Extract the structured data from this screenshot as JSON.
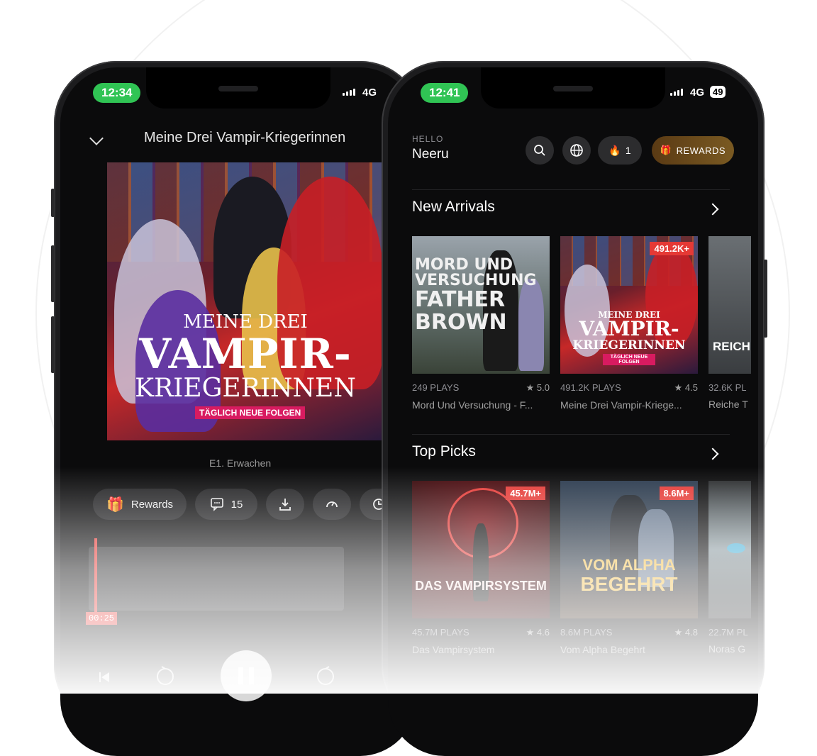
{
  "left_phone": {
    "status_time": "12:34",
    "network": "4G",
    "title": "Meine Drei Vampir-Kriegerinnen",
    "cover": {
      "line1": "MEINE DREI",
      "line2": "VAMPIR-",
      "line3": "KRIEGERINNEN",
      "tag": "TÄGLICH NEUE FOLGEN"
    },
    "episode": "E1. Erwachen",
    "controls": {
      "rewards_label": "Rewards",
      "comments_count": "15"
    },
    "timestamp": "00:25",
    "icons": [
      "chevron-down-icon",
      "gift-icon",
      "comment-icon",
      "download-icon",
      "speed-icon",
      "sleep-timer-icon",
      "skip-previous-icon",
      "rewind-10-icon",
      "pause-icon",
      "forward-10-icon"
    ]
  },
  "right_phone": {
    "status_time": "12:41",
    "network": "4G",
    "battery": "49",
    "hello": "HELLO",
    "username": "Neeru",
    "streak_count": "1",
    "rewards_label": "REWARDS",
    "sections": [
      {
        "title": "New Arrivals",
        "cards": [
          {
            "plays": "249 PLAYS",
            "rating": "5.0",
            "name": "Mord Und Versuchung - F...",
            "art_lines": [
              "MORD UND",
              "VERSUCHUNG",
              "FATHER",
              "BROWN"
            ],
            "badge": ""
          },
          {
            "plays": "491.2K PLAYS",
            "rating": "4.5",
            "name": "Meine Drei Vampir-Kriege...",
            "art_lines": [
              "MEINE DREI",
              "VAMPIR-",
              "KRIEGERINNEN",
              "TÄGLICH NEUE FOLGEN"
            ],
            "badge": "491.2K+"
          },
          {
            "plays": "32.6K PL",
            "rating": "",
            "name": "Reiche T",
            "art_lines": [
              "REICH"
            ],
            "badge": ""
          }
        ]
      },
      {
        "title": "Top Picks",
        "cards": [
          {
            "plays": "45.7M PLAYS",
            "rating": "4.6",
            "name": "Das Vampirsystem",
            "art_lines": [
              "DAS VAMPIRSYSTEM"
            ],
            "badge": "45.7M+"
          },
          {
            "plays": "8.6M PLAYS",
            "rating": "4.8",
            "name": "Vom Alpha Begehrt",
            "art_lines": [
              "VOM ALPHA",
              "BEGEHRT"
            ],
            "badge": "8.6M+"
          },
          {
            "plays": "22.7M PL",
            "rating": "",
            "name": "Noras G",
            "art_lines": [],
            "badge": ""
          }
        ]
      }
    ],
    "colors": {
      "status_green": "#30c454",
      "accent_red": "#e53935",
      "rewards_gold": "#7a5a22"
    }
  }
}
